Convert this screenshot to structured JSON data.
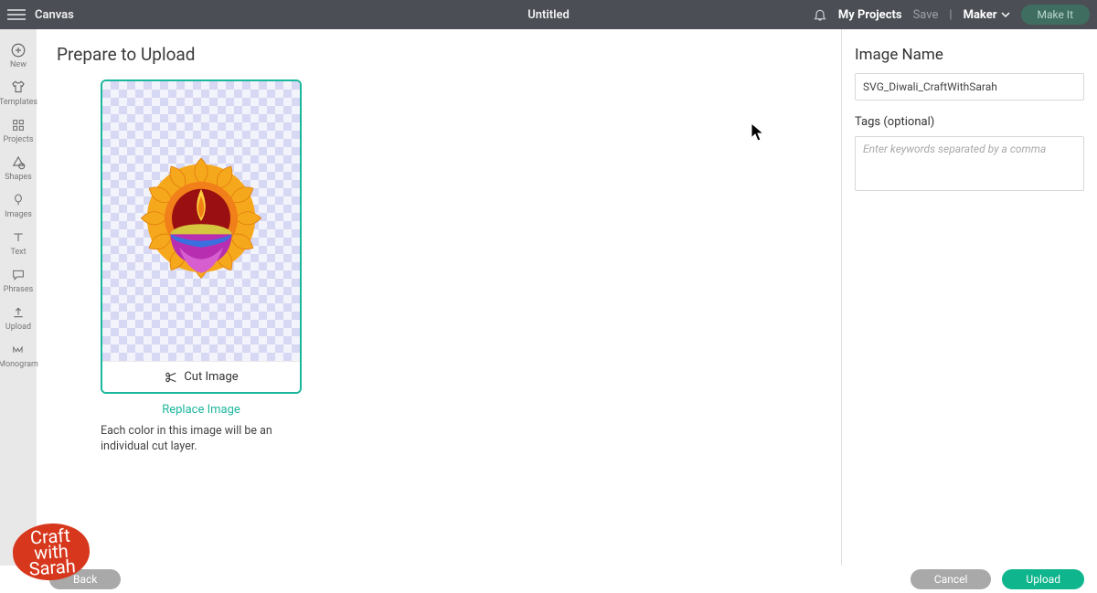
{
  "topbar": {
    "app": "Canvas",
    "title": "Untitled",
    "my_projects": "My Projects",
    "save": "Save",
    "separator": "|",
    "machine": "Maker",
    "make_it": "Make It"
  },
  "rail": [
    {
      "id": "new",
      "label": "New"
    },
    {
      "id": "templates",
      "label": "Templates"
    },
    {
      "id": "projects",
      "label": "Projects"
    },
    {
      "id": "shapes",
      "label": "Shapes"
    },
    {
      "id": "images",
      "label": "Images"
    },
    {
      "id": "text",
      "label": "Text"
    },
    {
      "id": "phrases",
      "label": "Phrases"
    },
    {
      "id": "upload",
      "label": "Upload"
    },
    {
      "id": "monogram",
      "label": "Monogram"
    }
  ],
  "main": {
    "heading": "Prepare to Upload",
    "cut_image": "Cut Image",
    "replace_image": "Replace Image",
    "note": "Each color in this image will be an individual cut layer."
  },
  "right": {
    "image_name_label": "Image Name",
    "image_name_value": "SVG_Diwali_CraftWithSarah",
    "tags_label": "Tags (optional)",
    "tags_placeholder": "Enter keywords separated by a comma"
  },
  "footer": {
    "back": "Back",
    "cancel": "Cancel",
    "upload": "Upload"
  },
  "watermark": "Craft with Sarah",
  "colors": {
    "accent": "#1cb69c",
    "primary_btn": "#0fb58d",
    "topbar": "#4b4e55"
  }
}
